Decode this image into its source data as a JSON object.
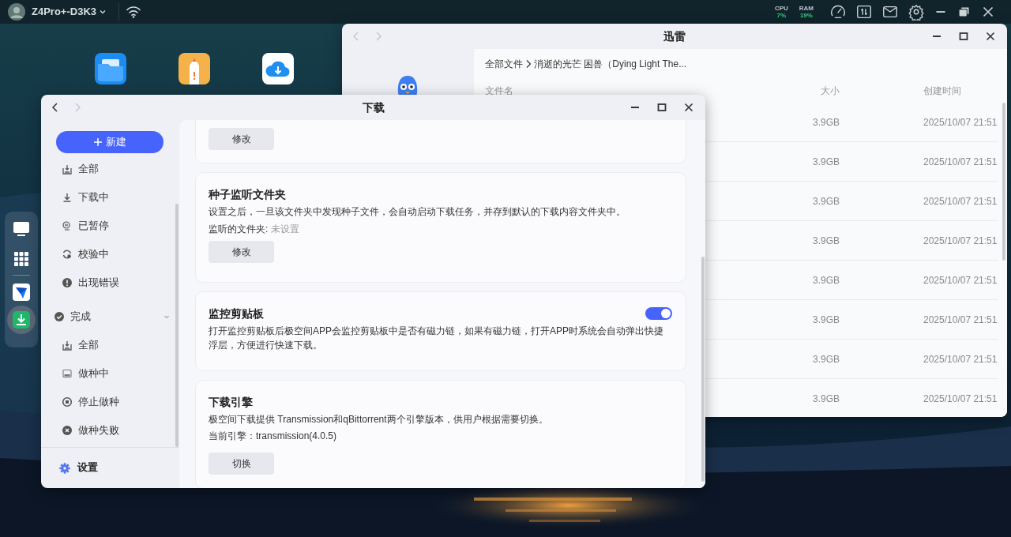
{
  "top_bar": {
    "device_name": "Z4Pro+-D3K3",
    "stats": [
      {
        "label": "CPU",
        "value": "7%"
      },
      {
        "label": "RAM",
        "value": "19%"
      }
    ]
  },
  "file_window": {
    "title": "迅雷",
    "breadcrumb": [
      "全部文件",
      "消逝的光芒 困兽（Dying Light The..."
    ],
    "columns": [
      "文件名",
      "大小",
      "创建时间"
    ],
    "rows": [
      {
        "size": "3.9GB",
        "created": "2025/10/07 21:51"
      },
      {
        "size": "3.9GB",
        "created": "2025/10/07 21:51"
      },
      {
        "size": "3.9GB",
        "created": "2025/10/07 21:51"
      },
      {
        "size": "3.9GB",
        "created": "2025/10/07 21:51"
      },
      {
        "size": "3.9GB",
        "created": "2025/10/07 21:51"
      },
      {
        "size": "3.9GB",
        "created": "2025/10/07 21:51"
      },
      {
        "size": "3.9GB",
        "created": "2025/10/07 21:51"
      },
      {
        "size": "3.9GB",
        "created": "2025/10/07 21:51"
      }
    ]
  },
  "download_window": {
    "title": "下载",
    "new_button": "新建",
    "sidebar": {
      "items": [
        {
          "kind": "all",
          "label": "全部",
          "selected": false
        },
        {
          "kind": "downloading",
          "label": "下载中",
          "selected": false
        },
        {
          "kind": "paused",
          "label": "已暂停",
          "selected": false
        },
        {
          "kind": "verifying",
          "label": "校验中",
          "selected": false
        },
        {
          "kind": "error",
          "label": "出现错误",
          "selected": false
        }
      ],
      "group": {
        "label": "完成",
        "expanded": true,
        "children": [
          {
            "kind": "all",
            "label": "全部",
            "selected": false
          },
          {
            "kind": "seeding",
            "label": "做种中",
            "selected": false
          },
          {
            "kind": "stopped",
            "label": "停止做种",
            "selected": false
          },
          {
            "kind": "failed",
            "label": "做种失败",
            "selected": false
          }
        ]
      },
      "settings": {
        "label": "设置",
        "selected": true
      }
    },
    "cards": [
      {
        "button": "修改"
      },
      {
        "title": "种子监听文件夹",
        "description": "设置之后，一旦该文件夹中发现种子文件，会自动启动下载任务，并存到默认的下载内容文件夹中。",
        "field_label": "监听的文件夹:",
        "field_value": "未设置",
        "button": "修改"
      },
      {
        "title": "监控剪贴板",
        "description": "打开监控剪贴板后极空间APP会监控剪贴板中是否有磁力链，如果有磁力链，打开APP时系统会自动弹出快捷浮层，方便进行快速下载。",
        "switch_on": true
      },
      {
        "title": "下载引擎",
        "description": "极空间下载提供 Transmission和qBittorrent两个引擎版本，供用户根据需要切换。",
        "detail": "当前引擎：transmission(4.0.5)",
        "button": "切换"
      }
    ]
  }
}
